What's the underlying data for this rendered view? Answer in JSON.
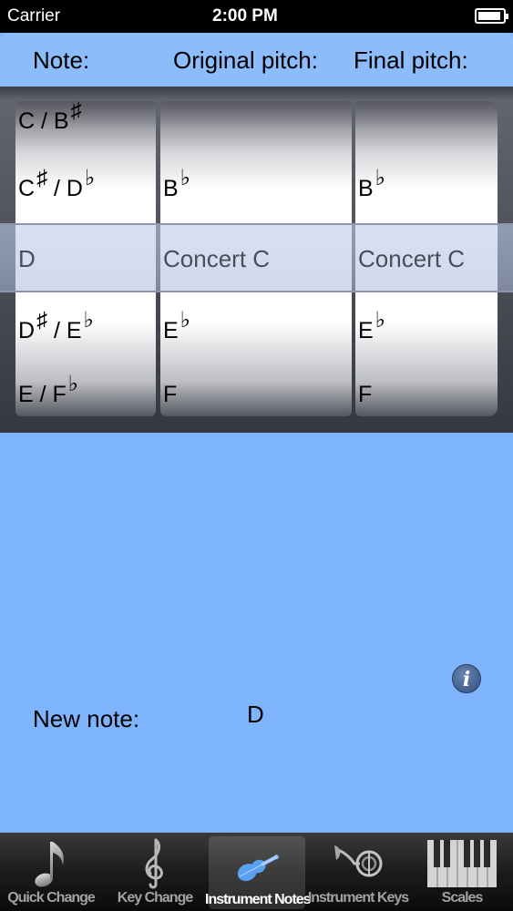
{
  "status_bar": {
    "carrier": "Carrier",
    "time": "2:00 PM"
  },
  "header": {
    "note_label": "Note:",
    "original_label": "Original pitch:",
    "final_label": "Final pitch:"
  },
  "picker": {
    "note_column": [
      {
        "text": "C / B",
        "accent": "♯"
      },
      {
        "text": "C",
        "mid": "♯",
        "text2": " / D",
        "accent": "♭"
      },
      {
        "text": "D"
      },
      {
        "text": "D",
        "mid": "♯",
        "text2": " / E",
        "accent": "♭"
      },
      {
        "text": "E / F",
        "accent": "♭"
      }
    ],
    "original_column": [
      {
        "text": ""
      },
      {
        "text": "B",
        "accent": "♭"
      },
      {
        "text": "Concert C"
      },
      {
        "text": "E",
        "accent": "♭"
      },
      {
        "text": "F"
      }
    ],
    "final_column": [
      {
        "text": ""
      },
      {
        "text": "B",
        "accent": "♭"
      },
      {
        "text": "Concert C"
      },
      {
        "text": "E",
        "accent": "♭"
      },
      {
        "text": "F"
      }
    ],
    "selected": {
      "note": "D",
      "original": "Concert C",
      "final": "Concert C"
    }
  },
  "main": {
    "info_icon": "i",
    "new_note_label": "New note:",
    "new_note_value": "D"
  },
  "tabbar": {
    "tabs": [
      {
        "label": "Quick Change",
        "icon": "eighth-note-icon",
        "active": false
      },
      {
        "label": "Key Change",
        "icon": "treble-clef-icon",
        "active": false
      },
      {
        "label": "Instrument Notes",
        "icon": "violin-icon",
        "active": true
      },
      {
        "label": "Instrument Keys",
        "icon": "french-horn-icon",
        "active": false
      },
      {
        "label": "Scales",
        "icon": "piano-keys-icon",
        "active": false
      }
    ]
  },
  "colors": {
    "background": "#7db4fb",
    "header": "#8cbdfa",
    "tabbar": "#1c1c1c",
    "active_icon": "#5aa0f0"
  }
}
